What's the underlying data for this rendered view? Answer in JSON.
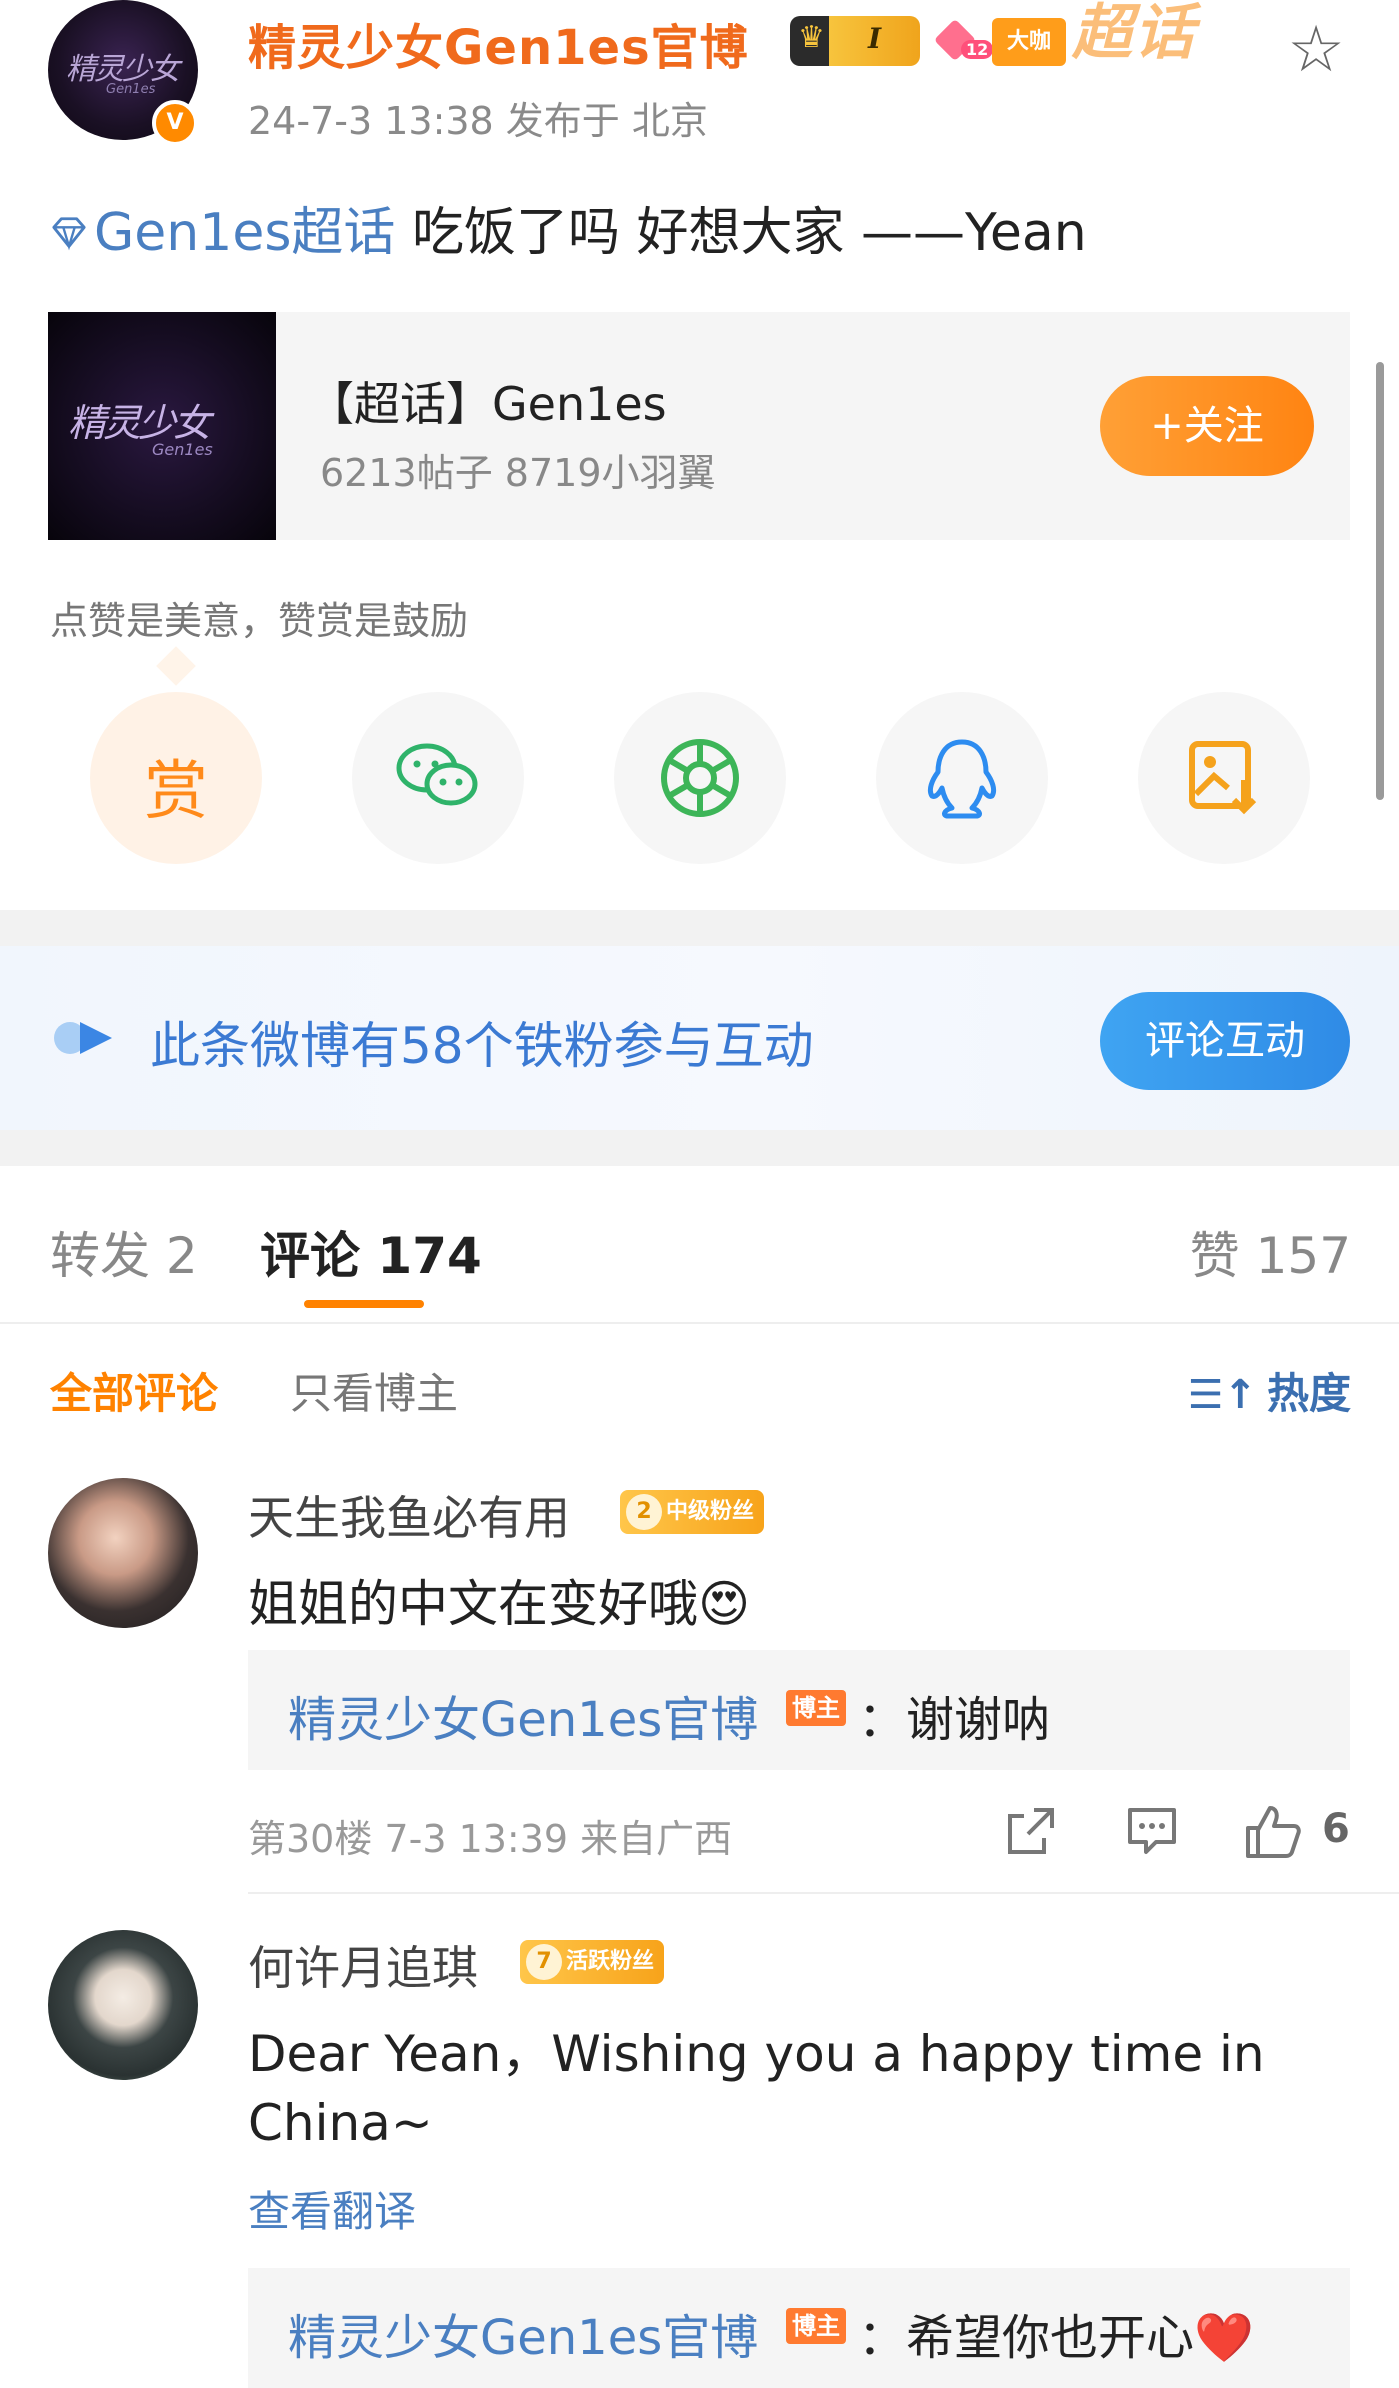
{
  "post": {
    "author": "精灵少女Gen1es官博",
    "author_level": "I",
    "gem_level": "12",
    "tag_daka": "大咖",
    "watermark": "超话",
    "meta": "24-7-3 13:38  发布于 北京",
    "topic": "Gen1es超话",
    "text": " 吃饭了吗 好想大家 ——Yean",
    "avatar_logo": "精灵少女",
    "avatar_logo_sub": "Gen1es"
  },
  "card": {
    "title": "【超话】Gen1es",
    "subtitle": "6213帖子 8719小羽翼",
    "follow": "+关注",
    "thumb_logo": "精灵少女",
    "thumb_logo_sub": "Gen1es"
  },
  "reward": {
    "tip": "点赞是美意，赞赏是鼓励",
    "reward_label": "赏",
    "icons": [
      "wechat-icon",
      "moments-icon",
      "qq-icon",
      "save-image-icon"
    ]
  },
  "banner": {
    "text": "此条微博有58个铁粉参与互动",
    "button": "评论互动"
  },
  "tabs": {
    "repost": "转发 2",
    "comments": "评论 174",
    "likes": "赞 157"
  },
  "filters": {
    "all": "全部评论",
    "author_only": "只看博主",
    "sort": "热度"
  },
  "comments": [
    {
      "user": "天生我鱼必有用",
      "badge_level": "2",
      "badge": "中级粉丝",
      "text": "姐姐的中文在变好哦",
      "emoji": "😍",
      "reply_user": "精灵少女Gen1es官博",
      "reply_tag": "博主",
      "reply_text": "：谢谢呐",
      "meta": "第30楼 7-3 13:39 来自广西",
      "like_count": "6"
    },
    {
      "user": "何许月追琪",
      "badge_level": "7",
      "badge": "活跃粉丝",
      "text_line1": "Dear Yean，Wishing you a happy time in",
      "text_line2": "China~",
      "translate": "查看翻译",
      "reply_user": "精灵少女Gen1es官博",
      "reply_tag": "博主",
      "reply_text": "：希望你也开心",
      "reply_emoji": "❤️"
    }
  ],
  "colors": {
    "accent_orange": "#ff8200",
    "link_blue": "#4a7fc1",
    "banner_blue": "#3b7ad3"
  }
}
